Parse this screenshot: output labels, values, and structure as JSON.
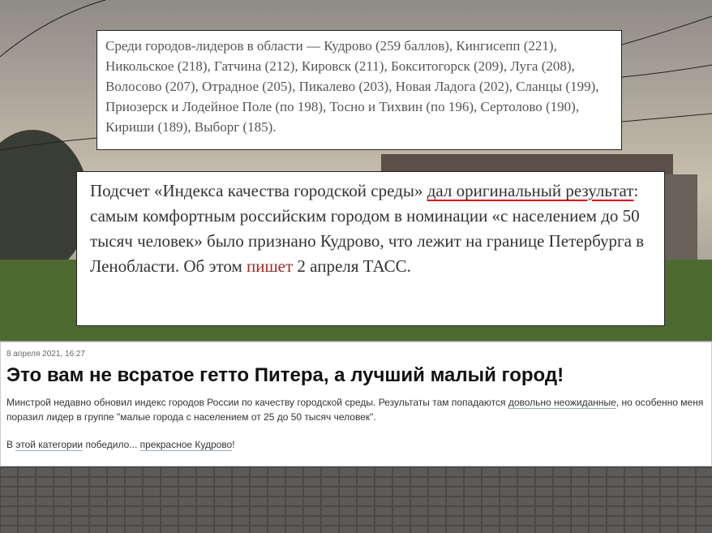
{
  "card_top": {
    "text": "Среди городов-лидеров в области — Кудрово (259 баллов), Кингисепп (221), Никольское (218), Гатчина (212), Кировск (211), Бокситогорск (209), Луга (208), Волосово (207), Отрадное (205), Пикалево (203), Новая Ладога (202), Сланцы (199), Приозерск и Лодейное Поле (по 198), Тосно и Тихвин (по 196), Сертолово (190), Кириши (189), Выборг (185)."
  },
  "card_middle": {
    "t1": "Подсчет «Индекса качества городской среды» ",
    "link1": "дал оригинальный результат",
    "t2": ": самым комфортным российским городом в номинации «с населением до 50 тысяч человек» было признано Кудрово, что лежит на границе Петербурга в Ленобласти. Об этом ",
    "link2": "пишет",
    "t3": " 2 апреля ТАСС."
  },
  "card_bottom": {
    "date": "8 апреля 2021, 16:27",
    "headline": "Это вам не всратое гетто Питера, а лучший малый город!",
    "p1_a": "Минстрой недавно обновил индекс городов России по качеству городской среды. Результаты там попадаются ",
    "p1_link": "довольно неожиданные",
    "p1_b": ", но особенно меня поразил лидер в группе \"малые города с населением от 25 до 50 тысяч человек\".",
    "p2_a": "В ",
    "p2_link1": "этой категории",
    "p2_b": " победило... ",
    "p2_link2": "прекрасное Кудрово",
    "p2_c": "!"
  }
}
